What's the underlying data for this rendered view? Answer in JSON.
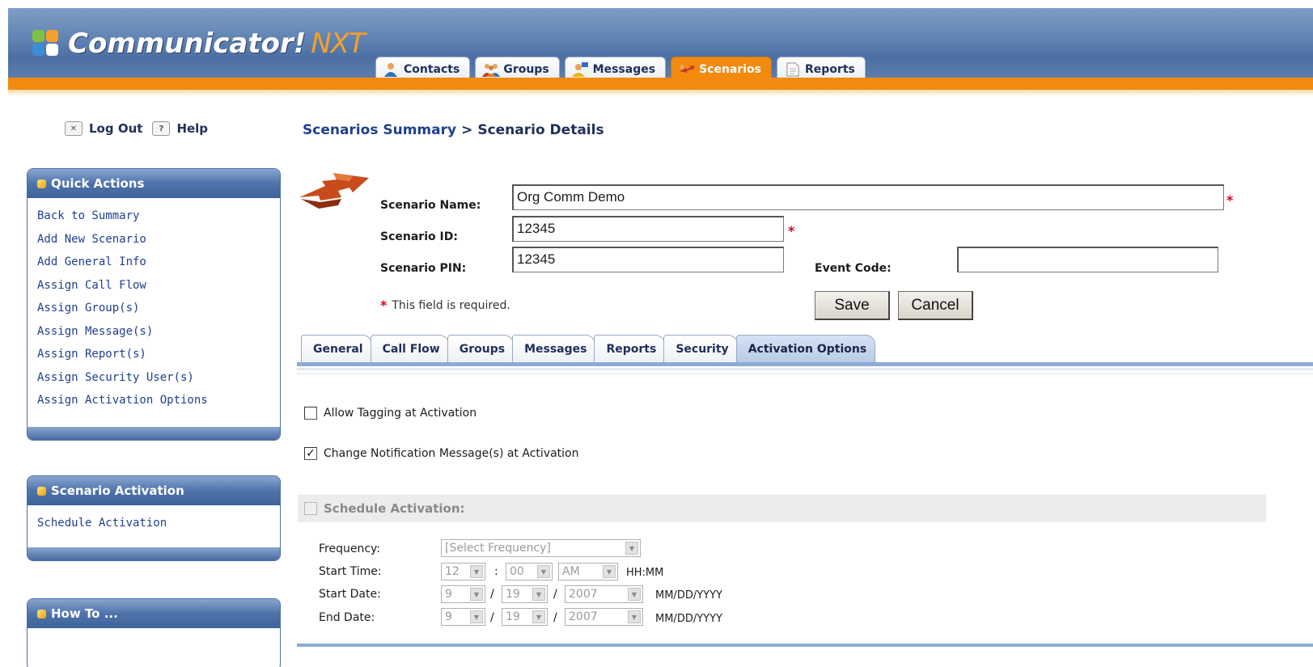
{
  "app": {
    "logo_main": "Communicator!",
    "logo_suffix": "NXT"
  },
  "top_tabs": [
    {
      "label": "Contacts",
      "icon": "contact-person-icon",
      "active": false
    },
    {
      "label": "Groups",
      "icon": "group-people-icon",
      "active": false
    },
    {
      "label": "Messages",
      "icon": "message-person-icon",
      "active": false
    },
    {
      "label": "Scenarios",
      "icon": "scenario-arrows-icon",
      "active": true
    },
    {
      "label": "Reports",
      "icon": "report-document-icon",
      "active": false
    }
  ],
  "session": {
    "logout_label": "Log Out",
    "help_label": "Help"
  },
  "quick_actions": {
    "title": "Quick Actions",
    "links": [
      "Back to Summary",
      "Add New Scenario",
      "Add General Info",
      "Assign Call Flow",
      "Assign Group(s)",
      "Assign Message(s)",
      "Assign Report(s)",
      "Assign Security User(s)",
      "Assign Activation Options"
    ]
  },
  "scenario_activation": {
    "title": "Scenario Activation",
    "links": [
      "Schedule Activation"
    ]
  },
  "how_to": {
    "title": "How To ..."
  },
  "breadcrumb": {
    "parent": "Scenarios Summary",
    "separator": ">",
    "current": "Scenario Details"
  },
  "form": {
    "name_label": "Scenario Name:",
    "name_value": "Org Comm Demo",
    "id_label": "Scenario ID:",
    "id_value": "12345",
    "pin_label": "Scenario PIN:",
    "pin_value": "12345",
    "event_code_label": "Event Code:",
    "event_code_value": "",
    "required_marker": "*",
    "required_note": "This field is required.",
    "save_label": "Save",
    "cancel_label": "Cancel"
  },
  "sub_tabs": [
    {
      "label": "General",
      "active": false
    },
    {
      "label": "Call Flow",
      "active": false
    },
    {
      "label": "Groups",
      "active": false
    },
    {
      "label": "Messages",
      "active": false
    },
    {
      "label": "Reports",
      "active": false
    },
    {
      "label": "Security",
      "active": false
    },
    {
      "label": "Activation Options",
      "active": true
    }
  ],
  "activation": {
    "allow_tagging_label": "Allow Tagging at Activation",
    "allow_tagging_checked": false,
    "change_msg_label": "Change Notification Message(s) at Activation",
    "change_msg_checked": true,
    "schedule_label": "Schedule Activation:",
    "schedule_checked": false,
    "frequency_label": "Frequency:",
    "frequency_value": "[Select Frequency]",
    "start_time_label": "Start Time:",
    "start_hour": "12",
    "start_minute": "00",
    "start_ampm": "AM",
    "time_format": "HH:MM",
    "time_sep": ":",
    "start_date_label": "Start Date:",
    "start_month": "9",
    "start_day": "19",
    "start_year": "2007",
    "end_date_label": "End Date:",
    "end_month": "9",
    "end_day": "19",
    "end_year": "2007",
    "date_sep": "/",
    "date_format": "MM/DD/YYYY"
  },
  "colors": {
    "header_blue": "#5f82b2",
    "accent_orange": "#f28a10",
    "link_blue": "#1f3f8f",
    "required_red": "#e0001a"
  }
}
